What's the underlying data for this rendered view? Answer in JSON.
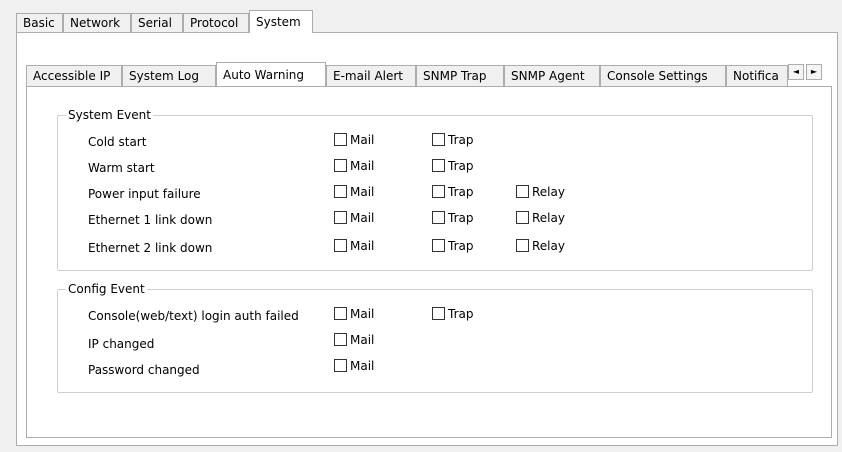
{
  "top_tabs": [
    {
      "label": "Basic"
    },
    {
      "label": "Network"
    },
    {
      "label": "Serial"
    },
    {
      "label": "Protocol"
    },
    {
      "label": "System",
      "active": true
    }
  ],
  "sub_tabs": [
    {
      "label": "Accessible IP"
    },
    {
      "label": "System Log"
    },
    {
      "label": "Auto Warning",
      "active": true
    },
    {
      "label": "E-mail Alert"
    },
    {
      "label": "SNMP Trap"
    },
    {
      "label": "SNMP Agent"
    },
    {
      "label": "Console Settings"
    },
    {
      "label": "Notifica"
    }
  ],
  "scroll": {
    "left_glyph": "◄",
    "right_glyph": "►"
  },
  "system_event": {
    "title": "System Event",
    "rows": [
      {
        "label": "Cold start",
        "mail": "Mail",
        "trap": "Trap"
      },
      {
        "label": "Warm start",
        "mail": "Mail",
        "trap": "Trap"
      },
      {
        "label": "Power input failure",
        "mail": "Mail",
        "trap": "Trap",
        "relay": "Relay"
      },
      {
        "label": "Ethernet 1 link down",
        "mail": "Mail",
        "trap": "Trap",
        "relay": "Relay"
      },
      {
        "label": "Ethernet 2 link down",
        "mail": "Mail",
        "trap": "Trap",
        "relay": "Relay"
      }
    ]
  },
  "config_event": {
    "title": "Config Event",
    "rows": [
      {
        "label": "Console(web/text) login auth failed",
        "mail": "Mail",
        "trap": "Trap"
      },
      {
        "label": "IP changed",
        "mail": "Mail"
      },
      {
        "label": "Password changed",
        "mail": "Mail"
      }
    ]
  }
}
